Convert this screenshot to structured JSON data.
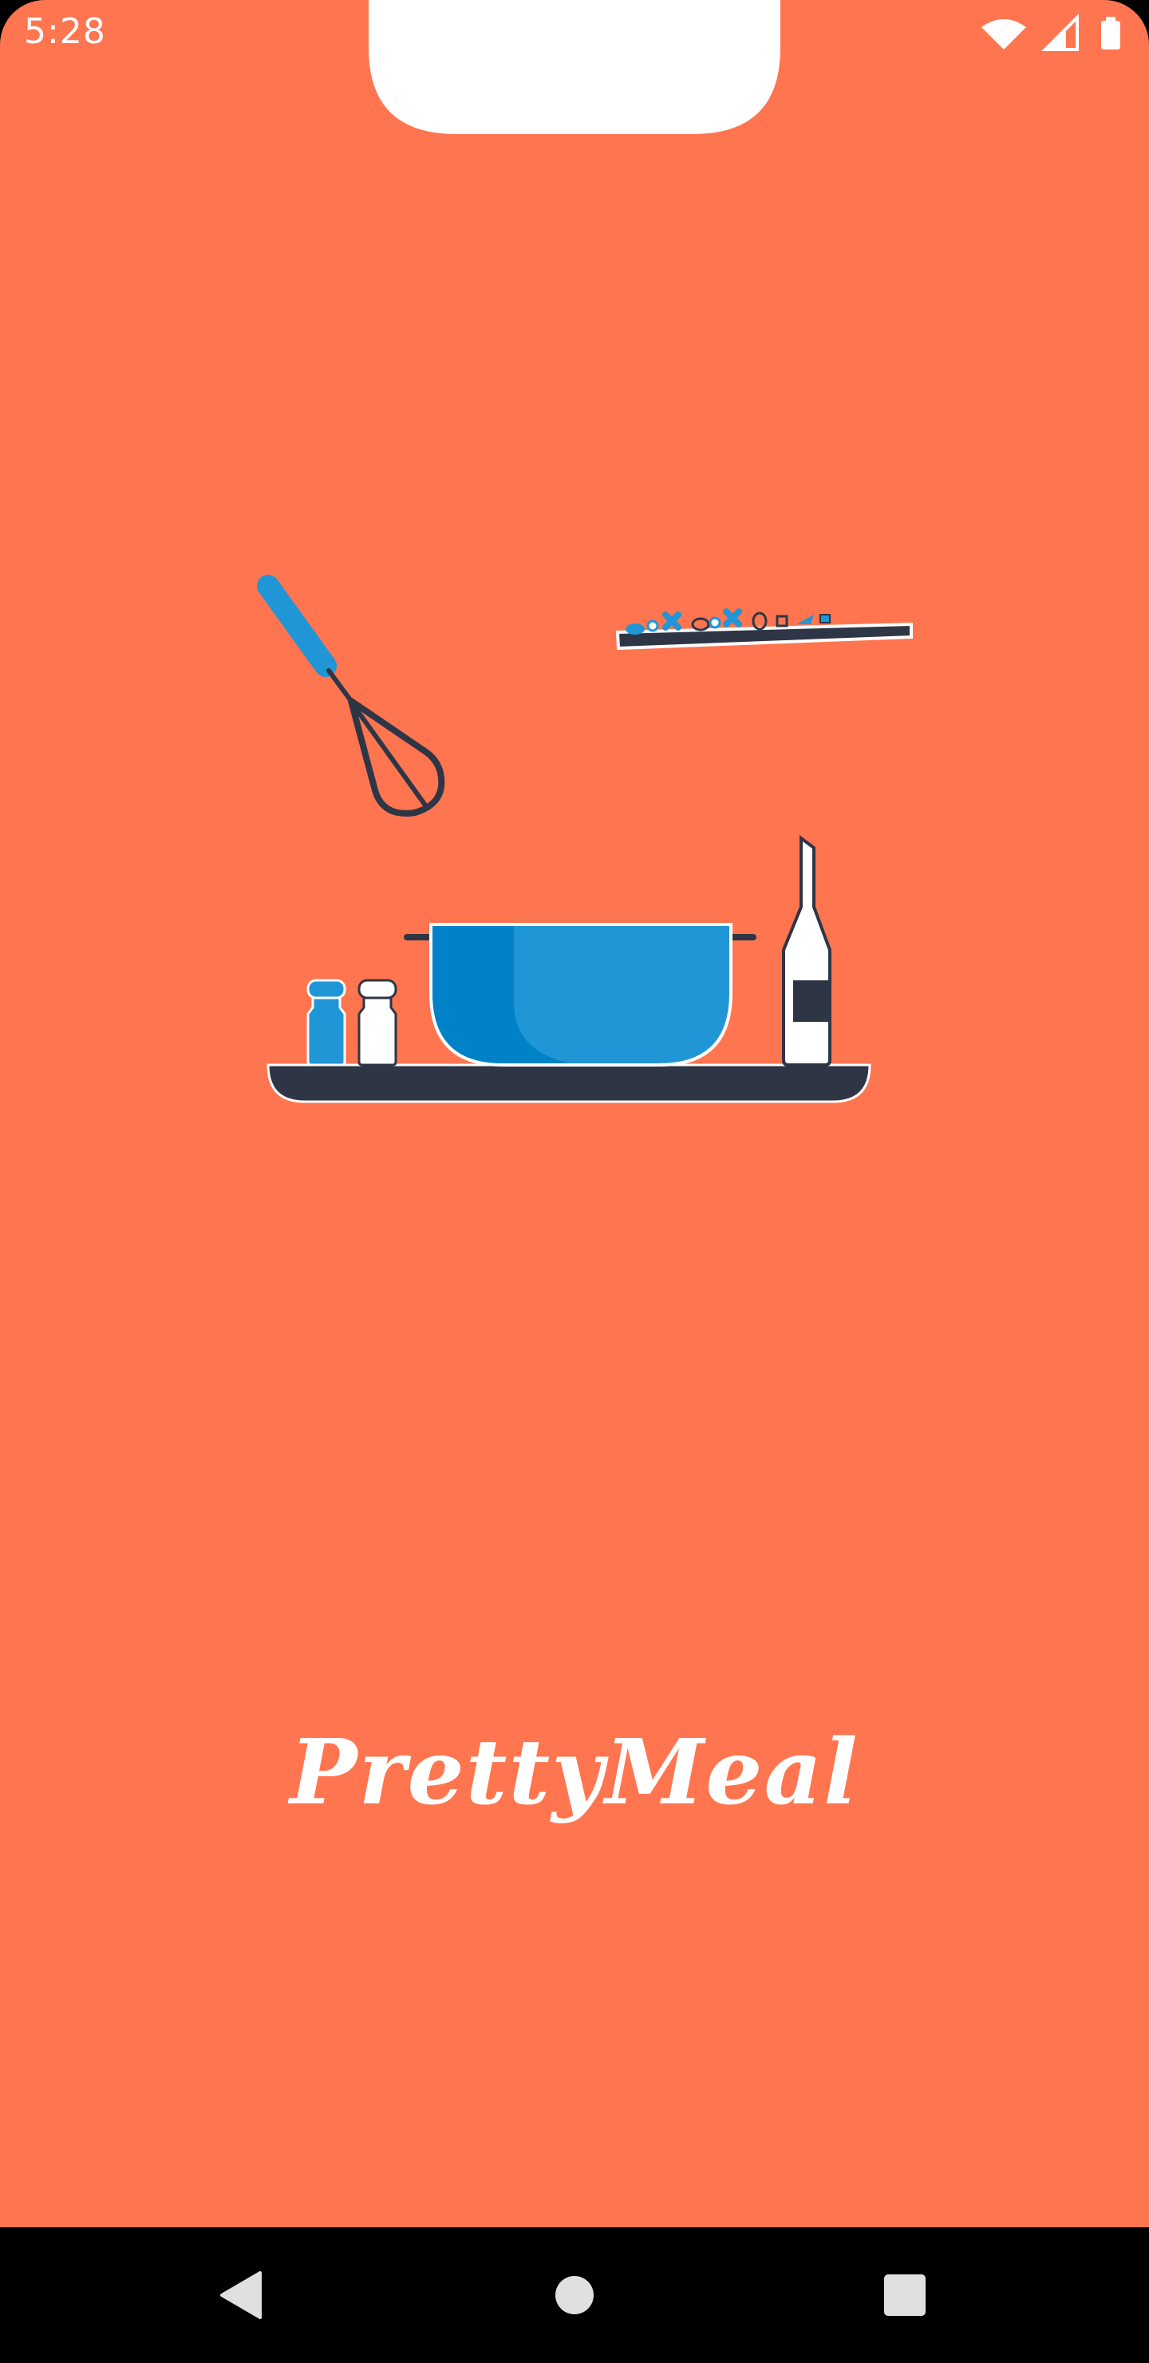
{
  "status_bar": {
    "time": "5:28",
    "icons": [
      "wifi-icon",
      "cellular-signal-icon",
      "battery-icon"
    ]
  },
  "splash": {
    "app_name": "PrettyMeal",
    "illustration": [
      "whisk",
      "tray-with-sprinkles",
      "salt-shaker",
      "pepper-shaker",
      "mixing-bowl",
      "oil-bottle",
      "serving-tray"
    ]
  },
  "nav_bar": {
    "buttons": [
      "back-icon",
      "home-icon",
      "recents-icon"
    ]
  },
  "colors": {
    "background": "#FF7550",
    "accent_blue": "#2196D6",
    "dark_blue": "#0082C8",
    "navy": "#2E3646",
    "white": "#FFFFFF",
    "nav_bar": "#000000"
  }
}
